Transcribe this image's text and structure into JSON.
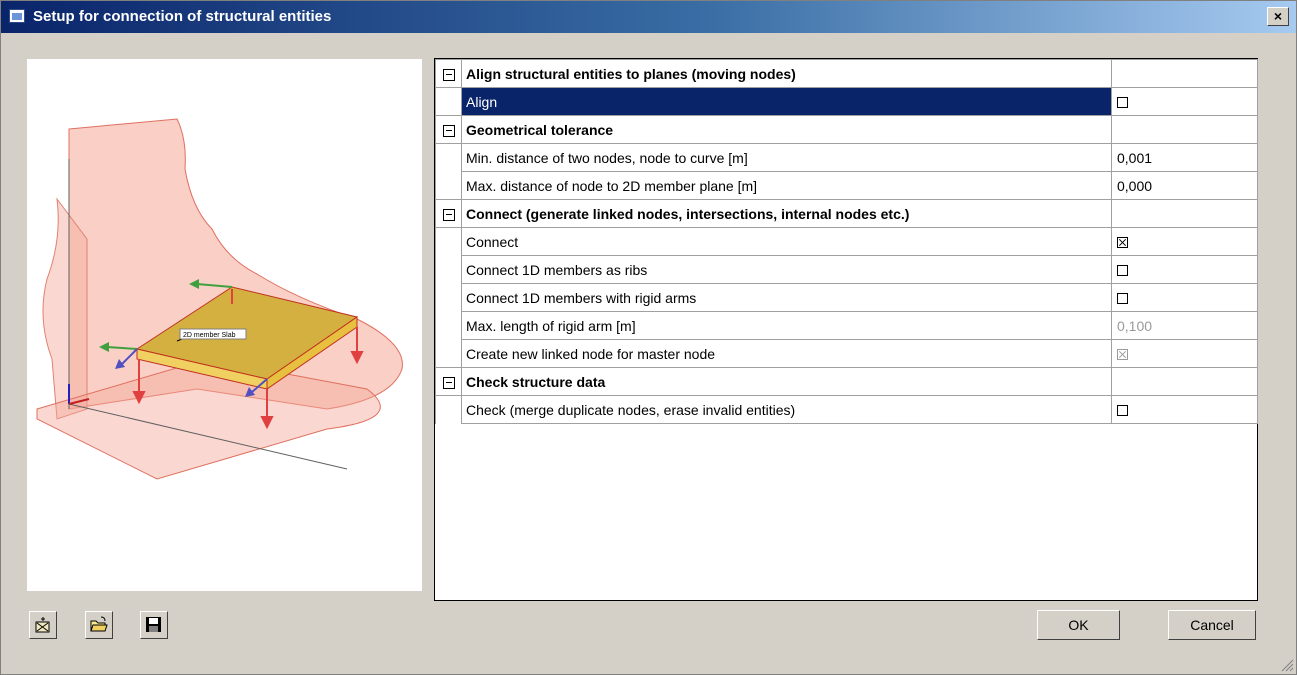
{
  "window": {
    "title": "Setup for connection of structural entities",
    "close_label": "×"
  },
  "preview": {
    "member_label": "2D member Slab"
  },
  "toolbar": {
    "icons": [
      "wizard-icon",
      "open-folder-icon",
      "save-disk-icon"
    ]
  },
  "properties": {
    "align_section": {
      "title": "Align structural entities to planes (moving nodes)",
      "rows": [
        {
          "label": "Align",
          "checked": false
        }
      ]
    },
    "tolerance_section": {
      "title": "Geometrical tolerance",
      "rows": [
        {
          "label": "Min. distance of two nodes, node to curve [m]",
          "value": "0,001"
        },
        {
          "label": "Max. distance of node to 2D member plane [m]",
          "value": "0,000"
        }
      ]
    },
    "connect_section": {
      "title": "Connect (generate linked nodes, intersections, internal nodes etc.)",
      "rows": [
        {
          "label": "Connect",
          "checked": true
        },
        {
          "label": "Connect 1D members as ribs",
          "checked": false
        },
        {
          "label": "Connect 1D members with rigid arms",
          "checked": false
        },
        {
          "label": "Max. length of rigid arm [m]",
          "value": "0,100"
        },
        {
          "label": "Create new linked node for master node",
          "checked": true
        }
      ]
    },
    "check_section": {
      "title": "Check structure data",
      "rows": [
        {
          "label": "Check (merge duplicate nodes, erase invalid entities)",
          "checked": false
        }
      ]
    }
  },
  "buttons": {
    "ok": "OK",
    "cancel": "Cancel"
  },
  "colors": {
    "title_active": "#0a246a",
    "selection": "#0a246a",
    "dialog_face": "#d4d0c8",
    "slab_fill": "#c8a030",
    "plane_fill": "#f4a898"
  }
}
